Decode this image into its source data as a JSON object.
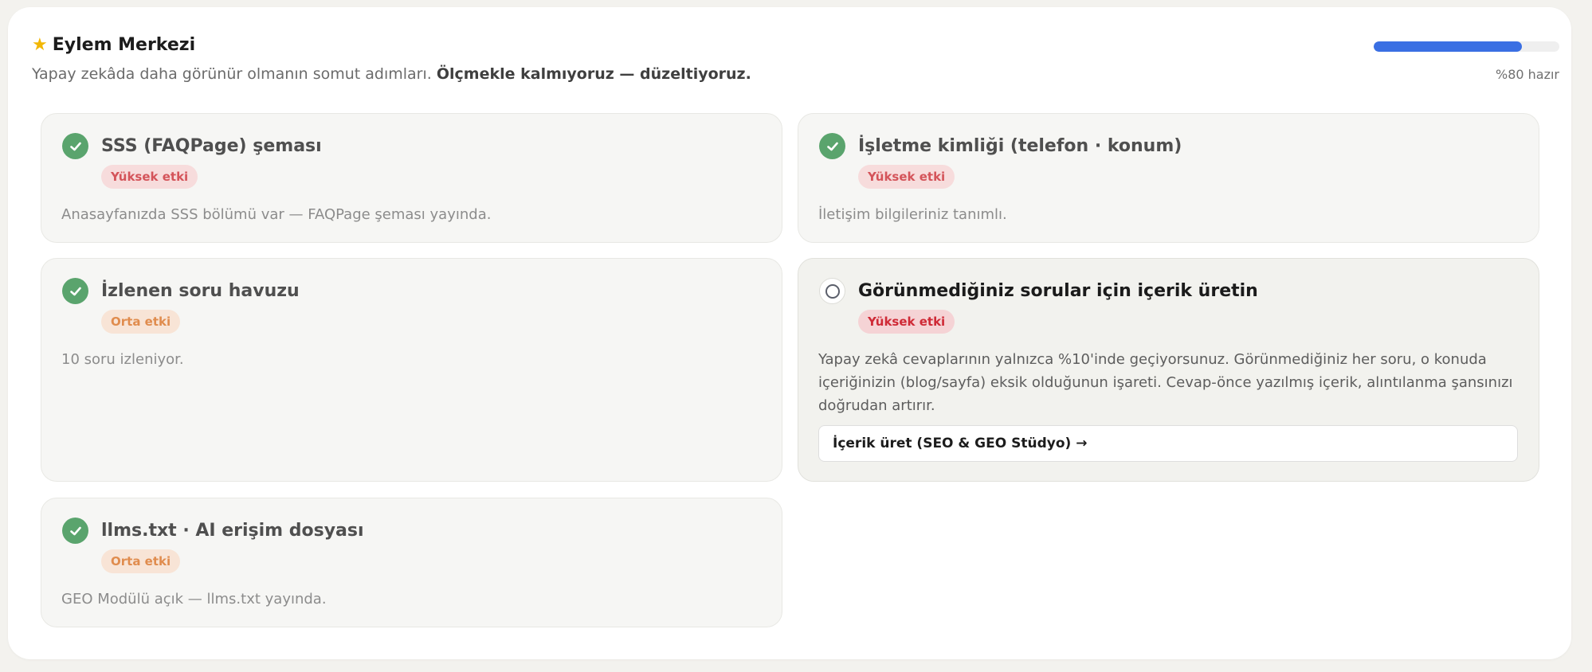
{
  "header": {
    "icon": "star-icon",
    "title": "Eylem Merkezi",
    "subtitle_plain": "Yapay zekâda daha görünür olmanın somut adımları.",
    "subtitle_bold": "Ölçmekle kalmıyoruz — düzeltiyoruz."
  },
  "progress": {
    "percent": 80,
    "label": "%80 hazır",
    "color": "#3a6fe3"
  },
  "cards": [
    {
      "title": "SSS (FAQPage) şeması",
      "badge": "Yüksek etki",
      "impact": "high",
      "done": true,
      "description": "Anasayfanızda SSS bölümü var — FAQPage şeması yayında."
    },
    {
      "title": "İşletme kimliği (telefon · konum)",
      "badge": "Yüksek etki",
      "impact": "high",
      "done": true,
      "description": "İletişim bilgileriniz tanımlı."
    },
    {
      "title": "İzlenen soru havuzu",
      "badge": "Orta etki",
      "impact": "medium",
      "done": true,
      "description": "10 soru izleniyor."
    },
    {
      "title": "Görünmediğiniz sorular için içerik üretin",
      "badge": "Yüksek etki",
      "impact": "high",
      "done": false,
      "description": "Yapay zekâ cevaplarının yalnızca %10'inde geçiyorsunuz. Görünmediğiniz her soru, o konuda içeriğinizin (blog/sayfa) eksik olduğunun işareti. Cevap-önce yazılmış içerik, alıntılanma şansınızı doğrudan artırır.",
      "action_label": "İçerik üret (SEO & GEO Stüdyo) →"
    },
    {
      "title": "llms.txt · AI erişim dosyası",
      "badge": "Orta etki",
      "impact": "medium",
      "done": true,
      "description": "GEO Modülü açık — llms.txt yayında."
    }
  ],
  "colors": {
    "check": "#5aa46d",
    "high_badge_text": "#d4545a",
    "medium_badge_text": "#e08c4e"
  }
}
